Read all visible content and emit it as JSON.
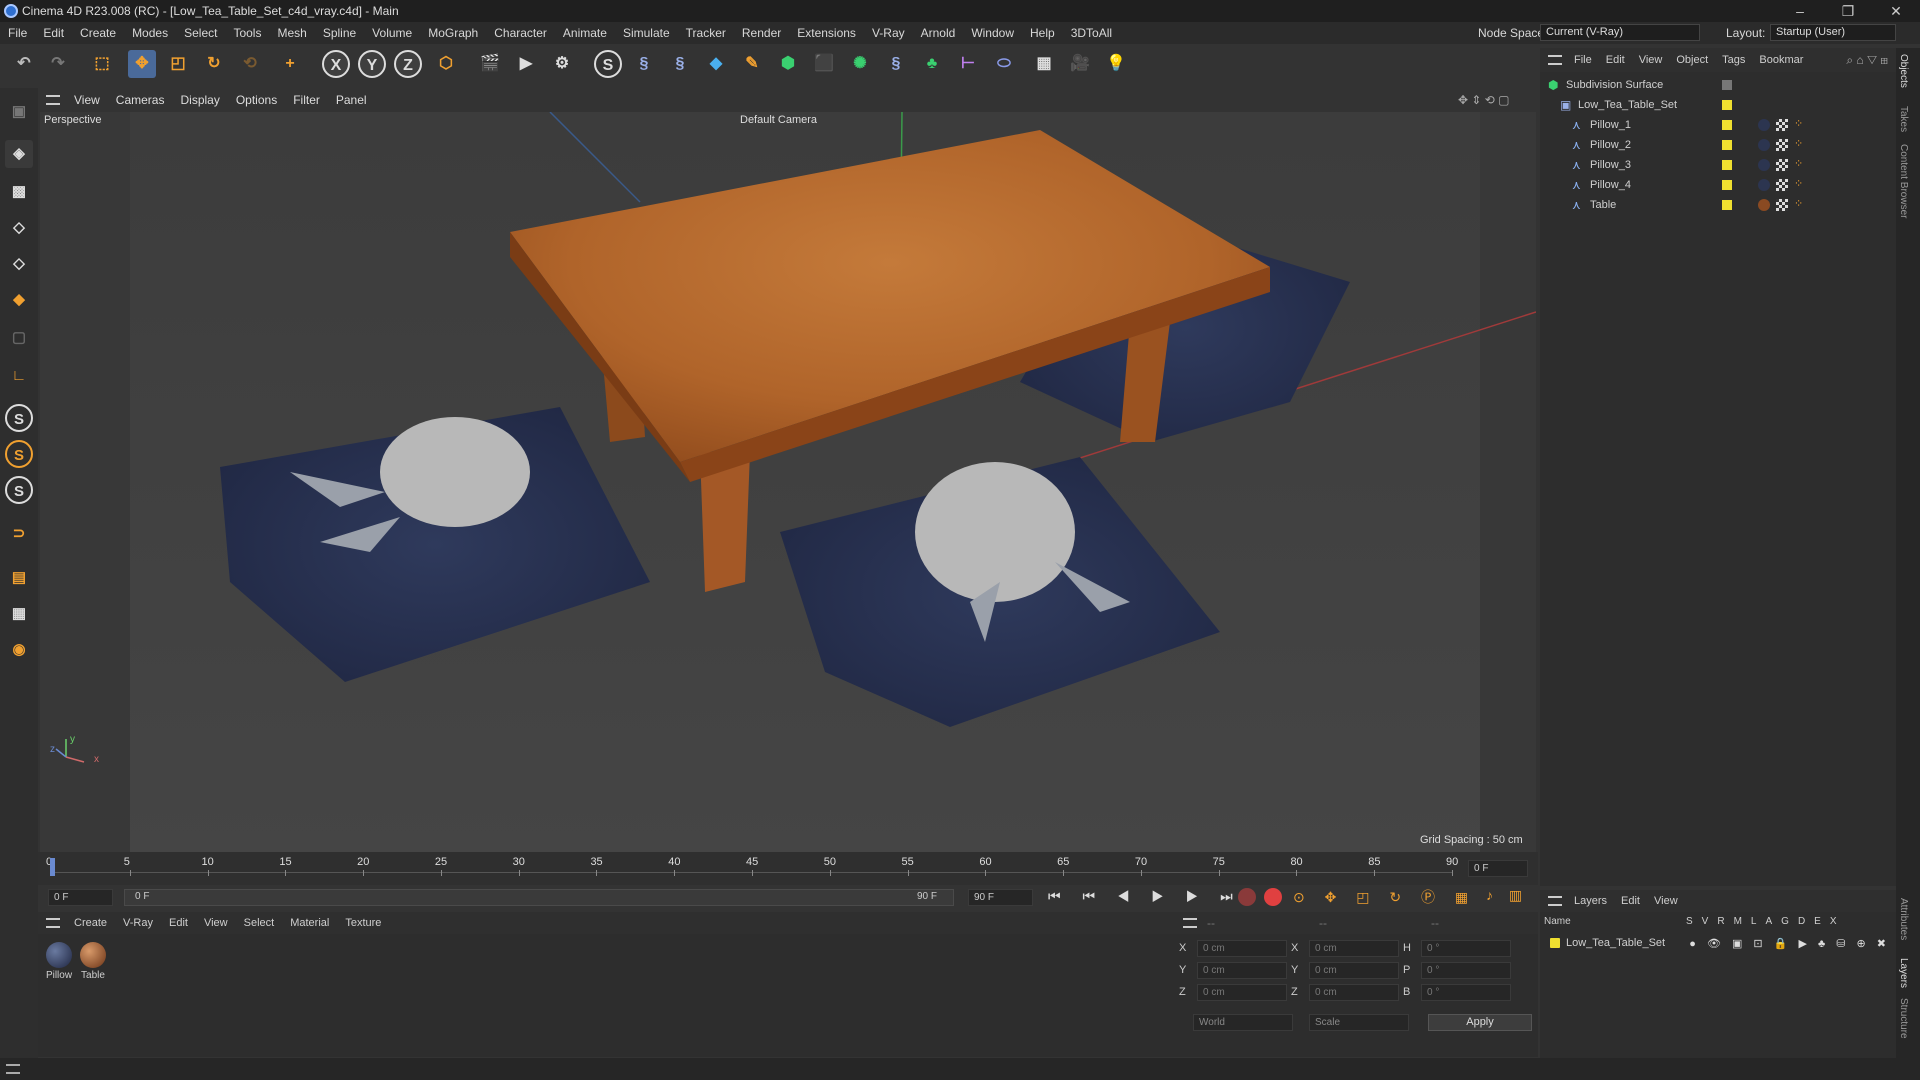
{
  "window": {
    "title": "Cinema 4D R23.008 (RC) - [Low_Tea_Table_Set_c4d_vray.c4d] - Main",
    "minimize": "–",
    "maximize": "❐",
    "close": "✕"
  },
  "menu": [
    "File",
    "Edit",
    "Create",
    "Modes",
    "Select",
    "Tools",
    "Mesh",
    "Spline",
    "Volume",
    "MoGraph",
    "Character",
    "Animate",
    "Simulate",
    "Tracker",
    "Render",
    "Extensions",
    "V-Ray",
    "Arnold",
    "Window",
    "Help",
    "3DToAll"
  ],
  "nodespace": {
    "label": "Node Space:",
    "value": "Current (V-Ray)"
  },
  "layout": {
    "label": "Layout:",
    "value": "Startup (User)"
  },
  "toolbar_axes": [
    "X",
    "Y",
    "Z"
  ],
  "viewport_menu": [
    "View",
    "Cameras",
    "Display",
    "Options",
    "Filter",
    "Panel"
  ],
  "viewport": {
    "name": "Perspective",
    "camera": "Default Camera",
    "grid_spacing": "Grid Spacing : 50 cm",
    "axis_y": "y",
    "axis_x": "x",
    "axis_z": "z"
  },
  "timeline": {
    "ticks": [
      "0",
      "5",
      "10",
      "15",
      "20",
      "25",
      "30",
      "35",
      "40",
      "45",
      "50",
      "55",
      "60",
      "65",
      "70",
      "75",
      "80",
      "85",
      "90"
    ],
    "current_frame": "0 F",
    "start": "0 F",
    "range_start": "0 F",
    "range_end": "90 F",
    "end": "90 F"
  },
  "materials_menu": [
    "Create",
    "V-Ray",
    "Edit",
    "View",
    "Select",
    "Material",
    "Texture"
  ],
  "materials": [
    {
      "name": "Pillow",
      "color": "#2c3550"
    },
    {
      "name": "Table",
      "color": "#8a4a22"
    }
  ],
  "coords": {
    "header_left": "--",
    "header_mid": "--",
    "header_right": "--",
    "rows": [
      {
        "l1": "X",
        "v1": "0 cm",
        "l2": "X",
        "v2": "0 cm",
        "l3": "H",
        "v3": "0 °"
      },
      {
        "l1": "Y",
        "v1": "0 cm",
        "l2": "Y",
        "v2": "0 cm",
        "l3": "P",
        "v3": "0 °"
      },
      {
        "l1": "Z",
        "v1": "0 cm",
        "l2": "Z",
        "v2": "0 cm",
        "l3": "B",
        "v3": "0 °"
      }
    ],
    "mode": "World",
    "mode2": "Scale",
    "apply": "Apply"
  },
  "objects_menu": [
    "File",
    "Edit",
    "View",
    "Object",
    "Tags",
    "Bookmar"
  ],
  "objects": [
    {
      "name": "Subdivision Surface",
      "level": 0
    },
    {
      "name": "Low_Tea_Table_Set",
      "level": 1
    },
    {
      "name": "Pillow_1",
      "level": 2
    },
    {
      "name": "Pillow_2",
      "level": 2
    },
    {
      "name": "Pillow_3",
      "level": 2
    },
    {
      "name": "Pillow_4",
      "level": 2
    },
    {
      "name": "Table",
      "level": 2
    }
  ],
  "layers_menu": [
    "Layers",
    "Edit",
    "View"
  ],
  "layers_header": {
    "name": "Name",
    "flags": [
      "S",
      "V",
      "R",
      "M",
      "L",
      "A",
      "G",
      "D",
      "E",
      "X"
    ]
  },
  "layers": [
    {
      "name": "Low_Tea_Table_Set",
      "color": "#f0e030"
    }
  ],
  "right_tabs": [
    "Objects",
    "Takes",
    "Content Browser",
    "Attributes",
    "Layers",
    "Structure"
  ],
  "colors": {
    "accent": "#4a8fe0",
    "layer_yellow": "#f0e030",
    "table_wood": "#b8692c",
    "pillow_blue": "#28314e"
  }
}
